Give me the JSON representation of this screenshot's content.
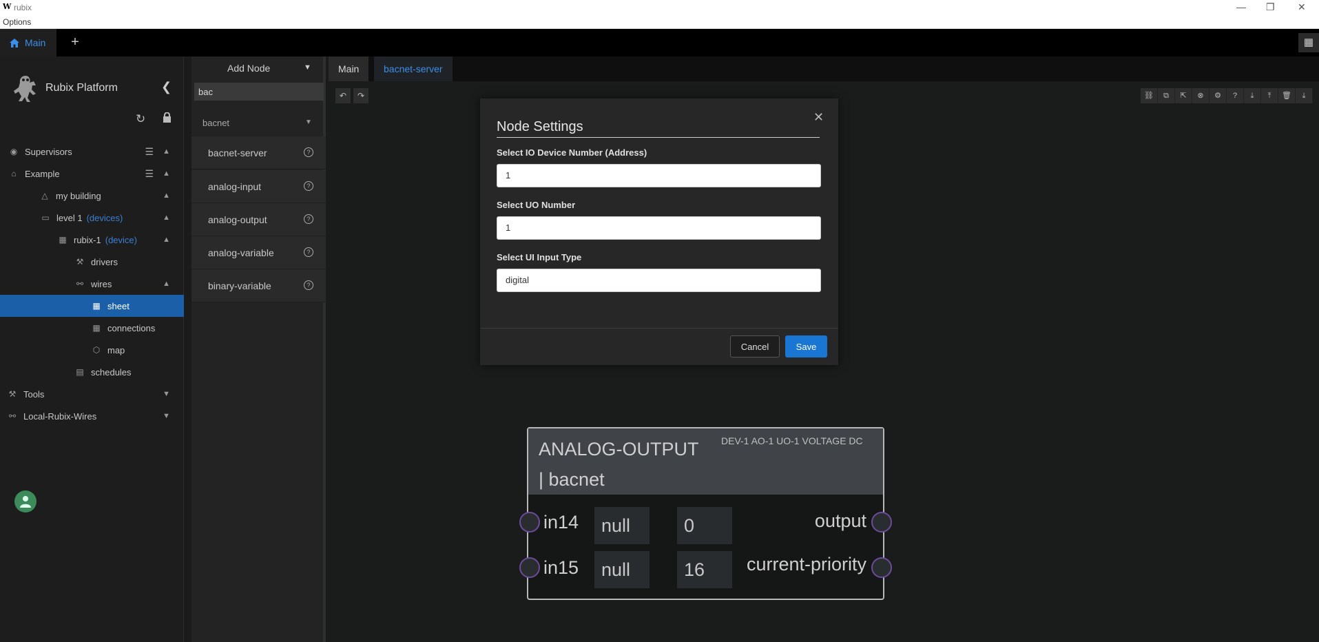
{
  "window": {
    "logo": "W",
    "title": "rubix",
    "minimize": "—",
    "restore": "❐",
    "close": "✕"
  },
  "menubar": {
    "options": "Options"
  },
  "tabstrip": {
    "main_tab": "Main",
    "add": "+",
    "layout_icon": "▦"
  },
  "sidebar": {
    "brand": "Rubix Platform",
    "items": [
      {
        "label": "Supervisors",
        "tag": ""
      },
      {
        "label": "Example",
        "tag": ""
      },
      {
        "label": "my building",
        "tag": ""
      },
      {
        "label": "level 1",
        "tag": "(devices)"
      },
      {
        "label": "rubix-1",
        "tag": "(device)"
      },
      {
        "label": "drivers",
        "tag": ""
      },
      {
        "label": "wires",
        "tag": ""
      },
      {
        "label": "sheet",
        "tag": ""
      },
      {
        "label": "connections",
        "tag": ""
      },
      {
        "label": "map",
        "tag": ""
      },
      {
        "label": "schedules",
        "tag": ""
      },
      {
        "label": "Tools",
        "tag": ""
      },
      {
        "label": "Local-Rubix-Wires",
        "tag": ""
      }
    ]
  },
  "palette": {
    "header": "Add Node",
    "search_value": "bac",
    "group": "bacnet",
    "items": [
      "bacnet-server",
      "analog-input",
      "analog-output",
      "analog-variable",
      "binary-variable"
    ]
  },
  "canvas": {
    "tabs": [
      "Main",
      "bacnet-server"
    ],
    "accent": "#3b8eea"
  },
  "modal": {
    "title": "Node Settings",
    "fields": [
      {
        "label": "Select IO Device Number (Address)",
        "value": "1"
      },
      {
        "label": "Select UO Number",
        "value": "1"
      },
      {
        "label": "Select UI Input Type",
        "value": "digital"
      }
    ],
    "cancel": "Cancel",
    "save": "Save"
  },
  "node": {
    "title": "ANALOG-OUTPUT | bacnet",
    "subtitle": "DEV-1 AO-1 UO-1 VOLTAGE DC",
    "inputs": [
      {
        "name": "in14",
        "value": "null",
        "default": "0"
      },
      {
        "name": "in15",
        "value": "null",
        "default": "16"
      }
    ],
    "outputs": [
      "output",
      "current-priority"
    ]
  }
}
